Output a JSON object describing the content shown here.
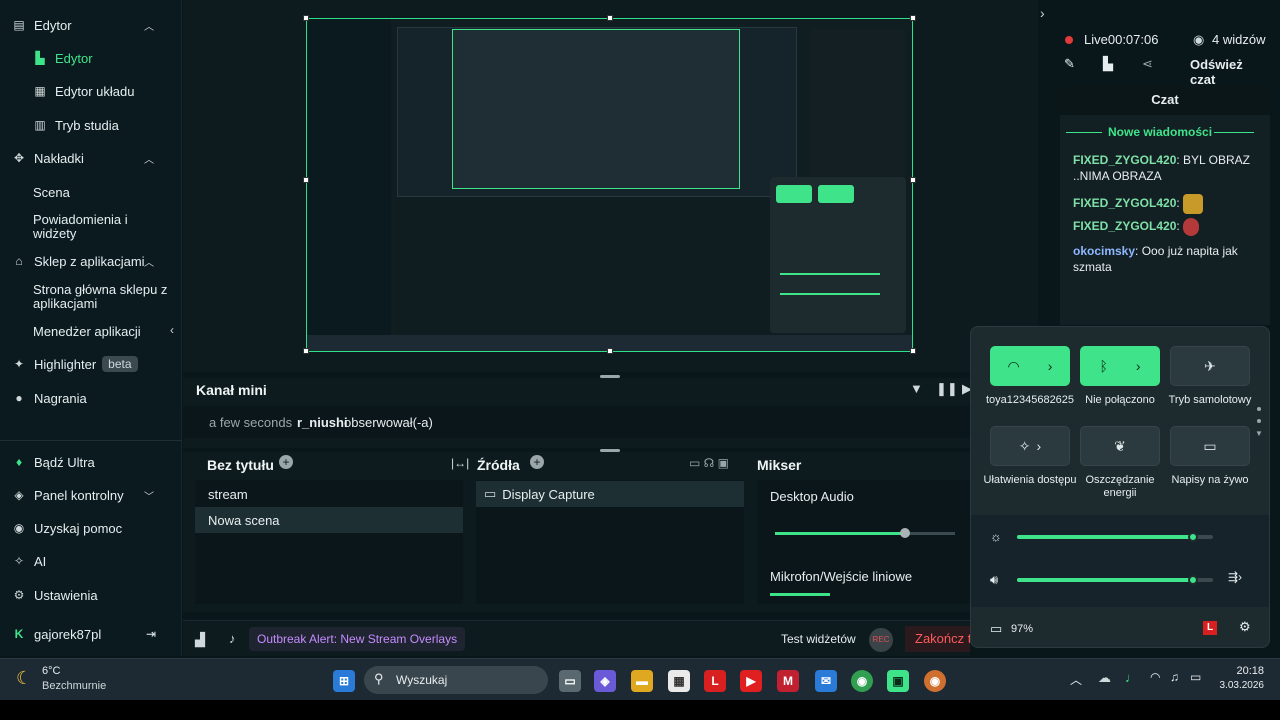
{
  "sidebar": {
    "groups": [
      {
        "label": "Edytor",
        "icon": "book-icon"
      },
      {
        "label": "Nakładki",
        "icon": "puzzle-icon"
      },
      {
        "label": "Sklep z aplikacjami",
        "icon": "store-icon"
      }
    ],
    "editor_items": [
      "Edytor",
      "Edytor układu",
      "Tryb studia"
    ],
    "overlay_items": [
      "Scena",
      "Powiadomienia i widżety"
    ],
    "store_items": [
      "Strona główna sklepu z aplikacjami",
      "Menedżer aplikacji"
    ],
    "highlighter": "Highlighter",
    "highlighter_badge": "beta",
    "recordings": "Nagrania",
    "ultra": "Bądź Ultra",
    "dashboard": "Panel kontrolny",
    "help": "Uzyskaj pomoc",
    "ai": "AI",
    "settings": "Ustawienia",
    "username": "gajorek87pl"
  },
  "mini": {
    "title": "Kanał mini",
    "time": "a few seconds",
    "user": "r_niushi",
    "action": "obserwował(-a)"
  },
  "scenes": {
    "title": "Bez tytułu",
    "items": [
      "stream",
      "Nowa scena"
    ]
  },
  "sources": {
    "title": "Źródła",
    "items": [
      "Display Capture"
    ]
  },
  "mixer": {
    "title": "Mikser",
    "desktop": "Desktop Audio",
    "mic": "Mikrofon/Wejście liniowe",
    "desktop_level": 0.72
  },
  "footer": {
    "alert": "Outbreak Alert: New Stream Overlays",
    "test_widgets": "Test widżetów",
    "rec": "REC",
    "end": "Zakończ tr"
  },
  "live": {
    "status": "Live",
    "time": "00:07:06",
    "viewers": "4 widzów",
    "refresh_chat": "Odśwież czat"
  },
  "chat": {
    "title": "Czat",
    "new_messages": "Nowe wiadomości",
    "messages": [
      {
        "user": "FIXED_ZYGOL420",
        "text": "BYL OBRAZ ..NIMA OBRAZA"
      },
      {
        "user": "FIXED_ZYGOL420",
        "text": ""
      },
      {
        "user": "FIXED_ZYGOL420",
        "text": ""
      },
      {
        "user": "okocimsky",
        "text": "Ooo już napita jak szmata"
      }
    ]
  },
  "quick_settings": {
    "wifi": "toya12345682625",
    "bluetooth": "Nie połączono",
    "airplane": "Tryb samolotowy",
    "accessibility": "Ułatwienia dostępu",
    "energy": "Oszczędzanie energii",
    "captions": "Napisy na żywo",
    "brightness_level": 0.9,
    "volume_level": 0.9,
    "battery": "97%"
  },
  "taskbar": {
    "temp": "6°C",
    "weather": "Bezchmurnie",
    "search": "Wyszukaj",
    "time": "20:18",
    "date": "3.03.2026"
  },
  "colors": {
    "accent": "#3fe48a",
    "background": "#09161a",
    "chat_user": "#7fe0a8",
    "okocimsky": "#8fb8ff"
  }
}
